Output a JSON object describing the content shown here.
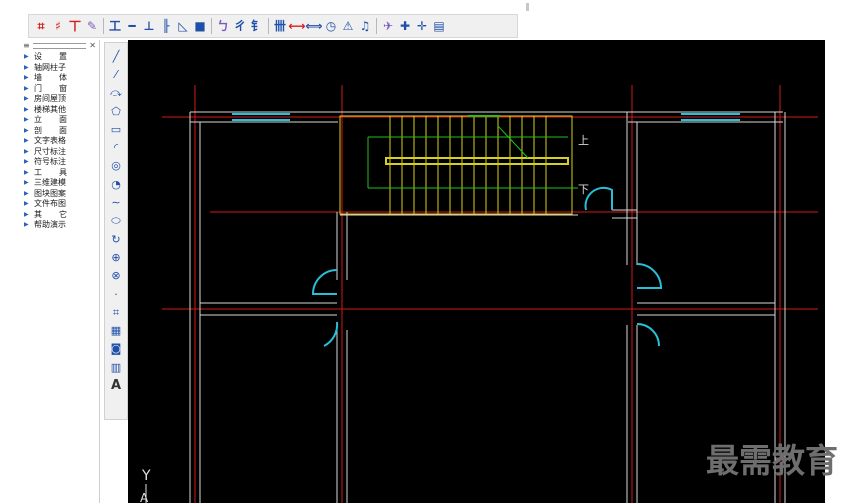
{
  "top_toolbar": {
    "buttons": [
      {
        "glyph": "⌗",
        "icon": "grid-icon",
        "color": "#d62020"
      },
      {
        "glyph": "♯",
        "icon": "axis-grid-icon",
        "color": "#d62020"
      },
      {
        "glyph": "丅",
        "icon": "column-icon",
        "color": "#d62020"
      },
      {
        "glyph": "✎",
        "icon": "edit-icon",
        "color": "#7a5cc0"
      },
      {
        "sep": true
      },
      {
        "glyph": "工",
        "icon": "wall-icon",
        "color": "#1f4fa8"
      },
      {
        "glyph": "━",
        "icon": "line-wall-icon",
        "color": "#1f4fa8"
      },
      {
        "glyph": "⊥",
        "icon": "window-icon",
        "color": "#1f4fa8"
      },
      {
        "glyph": "╟",
        "icon": "door-icon",
        "color": "#1f4fa8"
      },
      {
        "glyph": "◺",
        "icon": "stair-icon",
        "color": "#1f4fa8"
      },
      {
        "glyph": "■",
        "icon": "block-icon",
        "color": "#1f4fa8"
      },
      {
        "sep": true
      },
      {
        "glyph": "ㄅ",
        "icon": "elevation-icon",
        "color": "#7a5cc0"
      },
      {
        "glyph": "ㄔ",
        "icon": "section-icon",
        "color": "#1f4fa8"
      },
      {
        "glyph": "钅",
        "icon": "text-icon",
        "color": "#1f4fa8"
      },
      {
        "sep": true
      },
      {
        "glyph": "卌",
        "icon": "dim-icon",
        "color": "#1f4fa8"
      },
      {
        "glyph": "⟷",
        "icon": "dim-linear-icon",
        "color": "#d62020"
      },
      {
        "glyph": "⟺",
        "icon": "dim-chain-icon",
        "color": "#1f4fa8"
      },
      {
        "glyph": "◷",
        "icon": "dim-angle-icon",
        "color": "#1f4fa8"
      },
      {
        "glyph": "⚠",
        "icon": "symbol-icon",
        "color": "#1f4fa8"
      },
      {
        "glyph": "♫",
        "icon": "label-icon",
        "color": "#1f4fa8"
      },
      {
        "sep": true
      },
      {
        "glyph": "✈",
        "icon": "tool-icon",
        "color": "#7a5cc0"
      },
      {
        "glyph": "✚",
        "icon": "add-icon",
        "color": "#1f4fa8"
      },
      {
        "glyph": "✛",
        "icon": "move-icon",
        "color": "#1f4fa8"
      },
      {
        "glyph": "▤",
        "icon": "layer-icon",
        "color": "#1f4fa8"
      }
    ]
  },
  "sidebar": {
    "items": [
      {
        "label": "设置",
        "wide": true
      },
      {
        "label": "轴网柱子",
        "wide": false
      },
      {
        "label": "墙体",
        "wide": true
      },
      {
        "label": "门窗",
        "wide": true
      },
      {
        "label": "房间屋顶",
        "wide": false
      },
      {
        "label": "楼梯其他",
        "wide": false
      },
      {
        "label": "立面",
        "wide": true
      },
      {
        "label": "剖面",
        "wide": true
      },
      {
        "label": "文字表格",
        "wide": false
      },
      {
        "label": "尺寸标注",
        "wide": false
      },
      {
        "label": "符号标注",
        "wide": false
      },
      {
        "label": "工具",
        "wide": true
      },
      {
        "label": "三维建模",
        "wide": false
      },
      {
        "label": "图块图案",
        "wide": false
      },
      {
        "label": "文件布图",
        "wide": false
      },
      {
        "label": "其它",
        "wide": true
      },
      {
        "label": "帮助演示",
        "wide": false
      }
    ]
  },
  "draw_toolbar": {
    "buttons": [
      {
        "glyph": "╱",
        "icon": "line-icon"
      },
      {
        "glyph": "⁄",
        "icon": "polyline-icon"
      },
      {
        "glyph": "⤼",
        "icon": "arc-line-icon"
      },
      {
        "glyph": "⬠",
        "icon": "polygon-icon"
      },
      {
        "glyph": "▭",
        "icon": "rectangle-icon"
      },
      {
        "glyph": "◜",
        "icon": "arc-icon"
      },
      {
        "glyph": "◎",
        "icon": "circle-icon"
      },
      {
        "glyph": "◔",
        "icon": "cloud-icon"
      },
      {
        "glyph": "∼",
        "icon": "spline-icon"
      },
      {
        "glyph": "⬭",
        "icon": "ellipse-icon"
      },
      {
        "glyph": "↻",
        "icon": "revision-icon"
      },
      {
        "glyph": "⊕",
        "icon": "insert-block-icon"
      },
      {
        "glyph": "⊗",
        "icon": "make-block-icon"
      },
      {
        "glyph": "·",
        "icon": "point-icon"
      },
      {
        "glyph": "⌗",
        "icon": "hatch-icon"
      },
      {
        "glyph": "▦",
        "icon": "gradient-icon"
      },
      {
        "glyph": "◙",
        "icon": "region-icon"
      },
      {
        "glyph": "▥",
        "icon": "table-icon"
      },
      {
        "glyph": "A",
        "icon": "mtext-icon"
      }
    ]
  },
  "drawing": {
    "background": "#000000",
    "axis_color": "#d01818",
    "wall_color": "#d8d8d8",
    "door_color": "#28c0d8",
    "stair_color": "#d8d020",
    "annotation_color": "#20c020",
    "stair_label_up": "上",
    "stair_label_down": "下",
    "ucs_y": "Y",
    "ucs_x": "A"
  },
  "watermark": {
    "text": "最需教育",
    "color": "#6e6e6e"
  }
}
